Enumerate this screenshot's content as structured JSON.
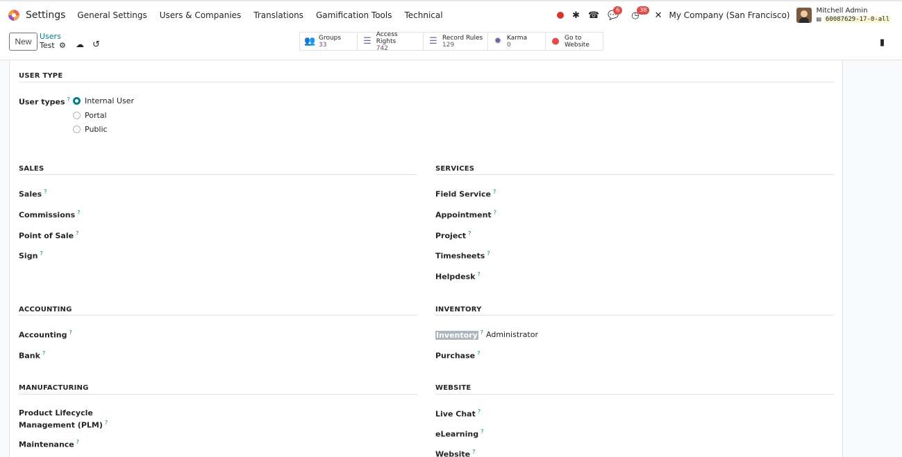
{
  "navbar": {
    "app_name": "Settings",
    "menu": [
      "General Settings",
      "Users & Companies",
      "Translations",
      "Gamification Tools",
      "Technical"
    ],
    "messages_count": "6",
    "activities_count": "38",
    "company": "My Company (San Francisco)",
    "user_name": "Mitchell Admin",
    "db_name": "60087629-17-0-all"
  },
  "control_panel": {
    "new_label": "New",
    "breadcrumb_parent": "Users",
    "breadcrumb_current": "Test",
    "smart_buttons": [
      {
        "label": "Groups",
        "value": "33",
        "icon": "users-icon"
      },
      {
        "label": "Access Rights",
        "value": "742",
        "icon": "list-icon"
      },
      {
        "label": "Record Rules",
        "value": "129",
        "icon": "list-icon"
      },
      {
        "label": "Karma",
        "value": "0",
        "icon": "badge-icon"
      },
      {
        "label": "Go to",
        "value": "Website",
        "icon": "globe-icon"
      }
    ]
  },
  "form": {
    "user_type": {
      "title": "USER TYPE",
      "label": "User types",
      "options": [
        "Internal User",
        "Portal",
        "Public"
      ],
      "selected": "Internal User"
    },
    "sales": {
      "title": "SALES",
      "fields": [
        "Sales",
        "Commissions",
        "Point of Sale",
        "Sign"
      ]
    },
    "services": {
      "title": "SERVICES",
      "fields": [
        "Field Service",
        "Appointment",
        "Project",
        "Timesheets",
        "Helpdesk"
      ]
    },
    "accounting": {
      "title": "ACCOUNTING",
      "fields": [
        "Accounting",
        "Bank"
      ]
    },
    "inventory": {
      "title": "INVENTORY",
      "fields": [
        "Inventory",
        "Purchase"
      ],
      "inventory_value": "Administrator"
    },
    "manufacturing": {
      "title": "MANUFACTURING",
      "fields": [
        "Product Lifecycle",
        "Management (PLM)",
        "Maintenance"
      ]
    },
    "website": {
      "title": "WEBSITE",
      "fields": [
        "Live Chat",
        "eLearning",
        "Website"
      ]
    }
  },
  "help_marker": "?"
}
